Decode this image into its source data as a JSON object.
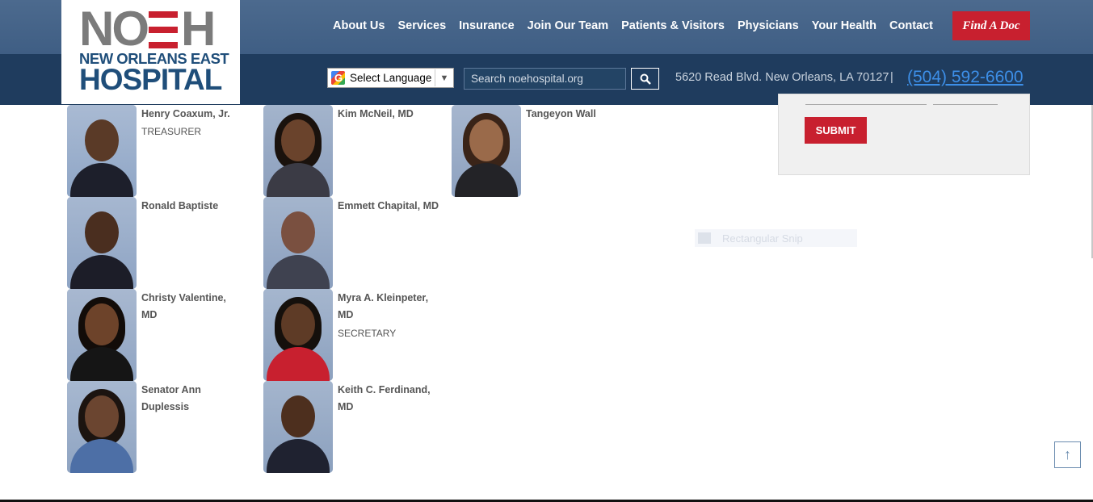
{
  "logo": {
    "top": "NO",
    "top_end": "H",
    "line2": "NEW ORLEANS EAST",
    "line3": "HOSPITAL"
  },
  "nav": {
    "items": [
      "About Us",
      "Services",
      "Insurance",
      "Join Our Team",
      "Patients & Visitors",
      "Physicians",
      "Your Health",
      "Contact"
    ],
    "find_doc": "Find A Doc"
  },
  "topbar": {
    "language_label": "Select Language",
    "language_caret": "▼",
    "search_placeholder": "Search noehospital.org",
    "address": "5620 Read Blvd. New Orleans, LA 70127",
    "separator": "|",
    "phone": "(504) 592-6600"
  },
  "board": {
    "members": [
      {
        "name": "Henry Coaxum, Jr.",
        "role": "TREASURER"
      },
      {
        "name": "Kim McNeil, MD",
        "role": ""
      },
      {
        "name": "Tangeyon Wall",
        "role": ""
      },
      {
        "name": "Ronald Baptiste",
        "role": ""
      },
      {
        "name": "Emmett Chapital, MD",
        "role": ""
      },
      {
        "name": "Christy Valentine, MD",
        "role": ""
      },
      {
        "name": "Myra A. Kleinpeter, MD",
        "role": "SECRETARY"
      },
      {
        "name": "Senator Ann Duplessis",
        "role": ""
      },
      {
        "name": " Keith C. Ferdinand, MD",
        "role": ""
      }
    ]
  },
  "form": {
    "submit_label": "SUBMIT"
  },
  "overlay": {
    "snip_label": "Rectangular Snip"
  },
  "scroll_top_icon": "↑",
  "colors": {
    "header_top": "#4c6a8e",
    "header_bottom": "#1f3c5e",
    "accent_red": "#c8202f",
    "phone_blue": "#3d8fe8",
    "logo_blue": "#1f4e7a"
  }
}
